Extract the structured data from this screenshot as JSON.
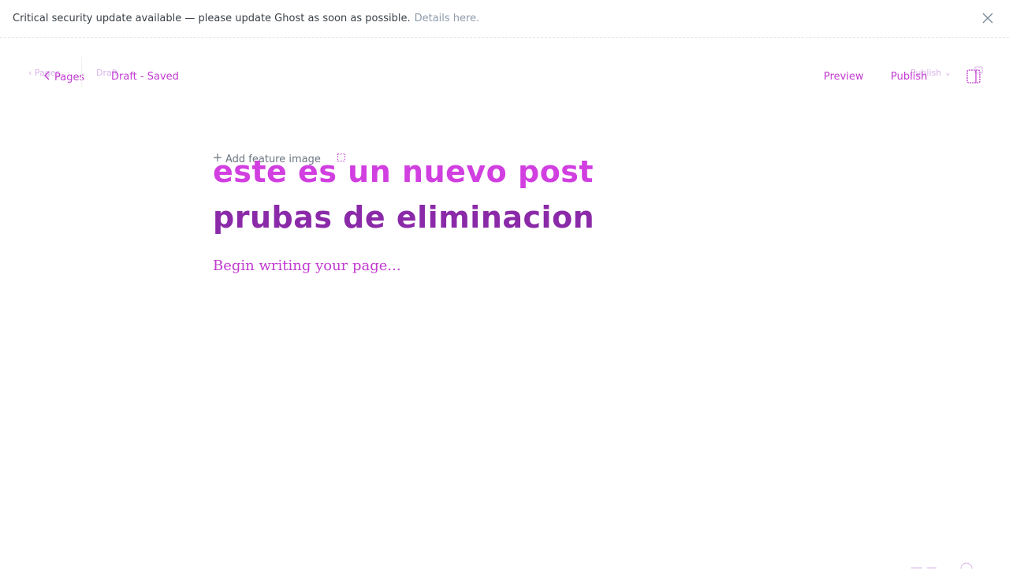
{
  "banner": {
    "message": "Critical security update available — please update Ghost as soon as possible.",
    "link_label": "Details here."
  },
  "header": {
    "back_label": "Pages",
    "back_ghost": "Pages",
    "status_label": "Draft - Saved",
    "status_ghost": "Draft",
    "preview_label": "Preview",
    "publish_label": "Publish",
    "publish_ghost": "Publish"
  },
  "editor": {
    "feature_image_label": "Add feature image",
    "title_line_1": "este es un nuevo post",
    "title_line_2": "prubas de eliminacion",
    "body_placeholder": "Begin writing your page..."
  },
  "colors": {
    "accent": "#c13ad0",
    "title_primary": "#d13fe0",
    "title_secondary": "#8a2aa8"
  }
}
